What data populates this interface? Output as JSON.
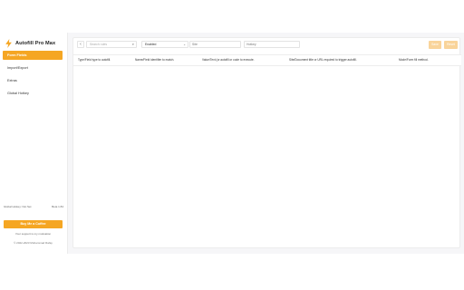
{
  "brand": {
    "name": "Autofill Pro Max"
  },
  "nav": {
    "items": [
      {
        "label": "Form Fields",
        "active": true
      },
      {
        "label": "Import/Export",
        "active": false
      },
      {
        "label": "Extras",
        "active": false
      },
      {
        "label": "Global Hotkey",
        "active": false
      }
    ]
  },
  "footer": {
    "hotkey_label": "Global Hotkey: Not Set",
    "version": "Beta 1.84",
    "coffee_label": "Buy Me a Coffee",
    "support_text": "Your support is my motivation",
    "copyright": "© 2022-2023 Muhammad Rafay"
  },
  "toolbar": {
    "back_label": "‹",
    "search_placeholder": "Search rules",
    "select_value": "Enabled",
    "site_placeholder": "Site",
    "hotkey_placeholder": "Hotkey",
    "save_label": "Save",
    "reset_label": "Reset"
  },
  "table": {
    "headers": [
      "Type/Field type to autofill.",
      "Name/Field identifier to match.",
      "Value/Text (or autofill or code to execute.",
      "Site/Document title or URL required to trigger autofill.",
      "Mode/Form fill method."
    ]
  },
  "colors": {
    "accent": "#f5a623",
    "accent_light": "#f9d49a"
  }
}
